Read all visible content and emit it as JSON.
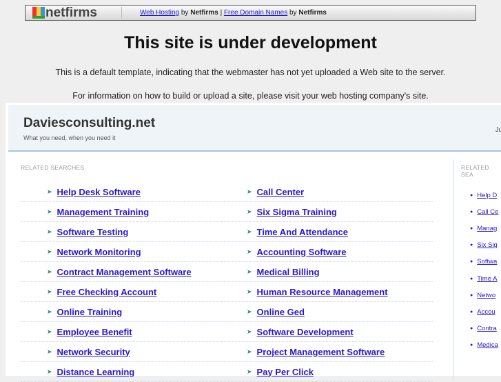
{
  "topbar": {
    "logo": "netfirms",
    "link1": "Web Hosting",
    "by1": "by",
    "brand1": "Netfirms",
    "sep": "|",
    "link2": "Free Domain Names",
    "by2": "by",
    "brand2": "Netfirms"
  },
  "title": "This site is under development",
  "para1": "This is a default template, indicating that the webmaster has not yet uploaded a Web site to the server.",
  "para2": "For information on how to build or upload a site, please visit your web hosting company's site.",
  "frame": {
    "site_name": "Daviesconsulting.net",
    "tagline": "What you need, when you need it",
    "date": "Ju",
    "related_label": "RELATED SEARCHES",
    "side_label": "RELATED SEA",
    "rows": [
      [
        "Help Desk Software",
        "Call Center"
      ],
      [
        "Management Training",
        "Six Sigma Training"
      ],
      [
        "Software Testing",
        "Time And Attendance"
      ],
      [
        "Network Monitoring",
        "Accounting Software"
      ],
      [
        "Contract Management Software",
        "Medical Billing"
      ],
      [
        "Free Checking Account",
        "Human Resource Management"
      ],
      [
        "Online Training",
        "Online Ged"
      ],
      [
        "Employee Benefit",
        "Software Development"
      ],
      [
        "Network Security",
        "Project Management Software"
      ],
      [
        "Distance Learning",
        "Pay Per Click"
      ]
    ],
    "side": [
      "Help D",
      "Call Ce",
      "Manag",
      "Six Sig",
      "Softwa",
      "Time A",
      "Netwo",
      "Accou",
      "Contra",
      "Medica"
    ]
  }
}
